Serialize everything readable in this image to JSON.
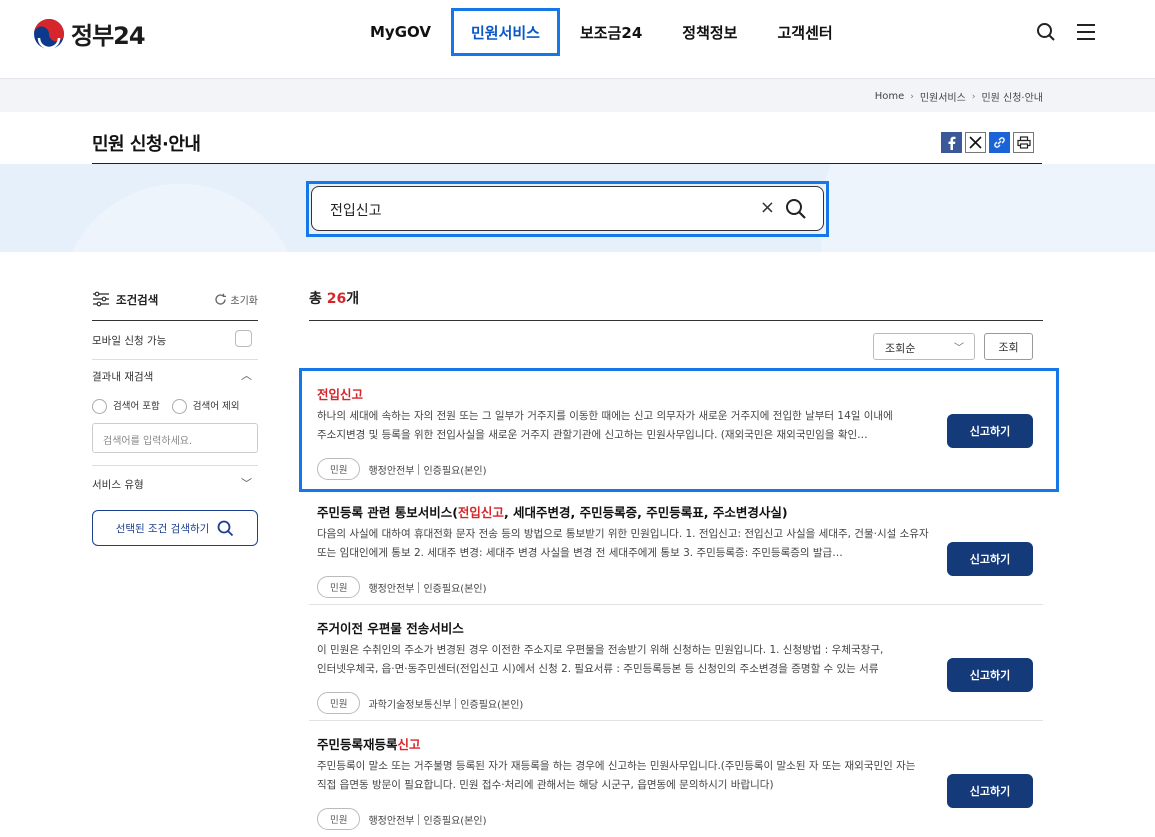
{
  "header": {
    "logo_text": "정부24",
    "nav": [
      "MyGOV",
      "민원서비스",
      "보조금24",
      "정책정보",
      "고객센터"
    ],
    "active_nav": "민원서비스"
  },
  "breadcrumb": [
    "Home",
    "민원서비스",
    "민원 신청·안내"
  ],
  "page_title": "민원 신청·안내",
  "search": {
    "value": "전입신고",
    "clear": "×"
  },
  "sidebar": {
    "title": "조건검색",
    "reset_label": "초기화",
    "mobile_label": "모바일 신청 가능",
    "refine_label": "결과내 재검색",
    "radio_include": "검색어 포함",
    "radio_exclude": "검색어 제외",
    "input_placeholder": "검색어를 입력하세요.",
    "service_type_label": "서비스 유형",
    "search_button": "선택된 조건 검색하기"
  },
  "results": {
    "count_prefix": "총 ",
    "count": "26",
    "count_suffix": "개",
    "sort_value": "조회순",
    "sort_button": "조회",
    "apply_label": "신고하기",
    "items": [
      {
        "title": "전입신고",
        "desc": "하나의 세대에 속하는 자의 전원 또는 그 일부가 거주지를 이동한 때에는 신고 의무자가 새로운 거주지에 전입한 날부터 14일 이내에 주소지변경 및 등록을 위한 전입사실을 새로운 거주지 관할기관에 신고하는 민원사무입니다. (재외국민은 재외국민임을 확인…",
        "tag": "민원",
        "agency": "행정안전부",
        "auth": "인증필요(본인)"
      },
      {
        "title_pre": "주민등록 관련 통보서비스(",
        "title_hl": "전입신고",
        "title_post": ", 세대주변경, 주민등록증, 주민등록표, 주소변경사실)",
        "desc": "다음의 사실에 대하여 휴대전화 문자 전송 등의 방법으로 통보받기 위한 민원입니다. 1. 전입신고: 전입신고 사실을 세대주, 건물·시설 소유자 또는 임대인에게 통보 2. 세대주 변경: 세대주 변경 사실을 변경 전 세대주에게 통보 3. 주민등록증: 주민등록증의 발급…",
        "tag": "민원",
        "agency": "행정안전부",
        "auth": "인증필요(본인)"
      },
      {
        "title": "주거이전 우편물 전송서비스",
        "desc": "이 민원은 수취인의 주소가 변경된 경우 이전한 주소지로 우편물을 전송받기 위해 신청하는 민원입니다. 1. 신청방법 : 우체국창구, 인터넷우체국, 읍·면·동주민센터(전입신고 시)에서 신청 2. 필요서류 : 주민등록등본 등 신청인의 주소변경을 증명할 수 있는 서류",
        "tag": "민원",
        "agency": "과학기술정보통신부",
        "auth": "인증필요(본인)"
      },
      {
        "title_pre": "주민등록재등록",
        "title_hl": "신고",
        "desc": "주민등록이 말소 또는 거주불명 등록된 자가 재등록을 하는 경우에 신고하는 민원사무입니다.(주민등록이 말소된 자 또는 재외국민인 자는 직접 읍면동 방문이 필요합니다. 민원 접수·처리에 관해서는 해당 시군구, 읍면동에 문의하시기 바랍니다)",
        "tag": "민원",
        "agency": "행정안전부",
        "auth": "인증필요(본인)"
      }
    ]
  }
}
